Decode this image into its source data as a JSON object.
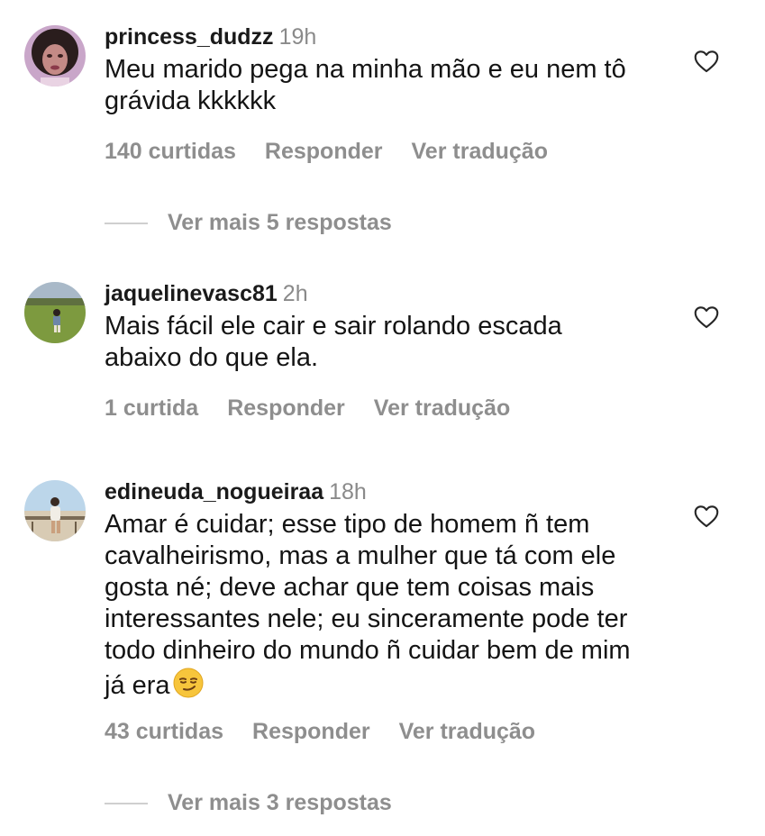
{
  "comments": [
    {
      "username": "princess_dudzz",
      "time": "19h",
      "text": "Meu marido pega na minha mão e eu nem tô grávida kkkkkk",
      "likes": "140 curtidas",
      "reply": "Responder",
      "translate": "Ver tradução",
      "more_replies": "Ver mais 5 respostas"
    },
    {
      "username": "jaquelinevasc81",
      "time": "2h",
      "text": "Mais fácil ele cair e sair rolando escada abaixo do que ela.",
      "likes": "1 curtida",
      "reply": "Responder",
      "translate": "Ver tradução"
    },
    {
      "username": "edineuda_nogueiraa",
      "time": "18h",
      "text": "Amar é cuidar; esse tipo de homem ñ tem cavalheirismo, mas a mulher que tá com ele gosta né; deve achar que tem coisas mais interessantes nele; eu sinceramente pode ter todo dinheiro do mundo ñ cuidar bem de mim já era",
      "likes": "43 curtidas",
      "reply": "Responder",
      "translate": "Ver tradução",
      "more_replies": "Ver mais 3 respostas"
    }
  ],
  "icons": {
    "like": "heart-outline-icon",
    "emoji": "smirking-face-emoji"
  },
  "colors": {
    "secondary_text": "#8e8e8e",
    "primary_text": "#141414"
  }
}
